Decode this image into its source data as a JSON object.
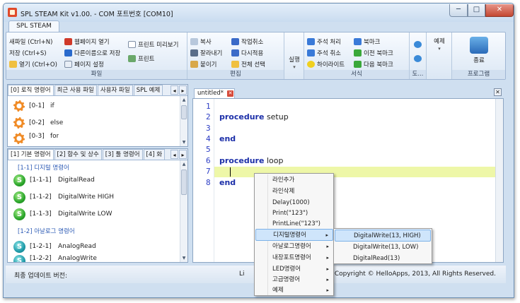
{
  "window": {
    "title": "SPL STEAM Kit v1.00.  - COM 포트번호 [COM10]",
    "min": "─",
    "max": "□",
    "close": "✕"
  },
  "ribbon": {
    "tab": "SPL STEAM",
    "file": {
      "label": "파일",
      "new": "새파일 (Ctrl+N)",
      "save": "저장 (Ctrl+S)",
      "open": "열기 (Ctrl+O)",
      "open_webpage": "웹페이지 열기",
      "save_as": "다른이름으로 저장",
      "page_setup": "페이지 설정",
      "print_preview": "프린트 미리보기",
      "print": "프린트"
    },
    "edit": {
      "label": "편집",
      "copy": "복사",
      "cut": "잘라내기",
      "paste": "붙이기",
      "undo": "작업취소",
      "redo": "다시적용",
      "select_all": "전체 선택"
    },
    "run": {
      "label": "실행",
      "arrow": "▾"
    },
    "format": {
      "label": "서식",
      "comment": "주석 처리",
      "uncomment": "주석 취소",
      "highlight": "하이라이트",
      "bookmark": "북마크",
      "prev_bookmark": "이전 북마크",
      "next_bookmark": "다음 북마크"
    },
    "misc": {
      "label": "도..."
    },
    "example": {
      "label": "예제",
      "arrow": "▾"
    },
    "program": {
      "label": "프로그램",
      "exit": "종료"
    }
  },
  "left_top": {
    "tabs": [
      "[0] 로직 명령어",
      "최근 사용 파일",
      "사용자 파일",
      "SPL 예제"
    ],
    "nav_prev": "◂",
    "nav_next": "▸",
    "items": [
      {
        "code": "[0-1]",
        "name": "if"
      },
      {
        "code": "[0-2]",
        "name": "else"
      },
      {
        "code": "[0-3]",
        "name": "for"
      }
    ]
  },
  "left_bottom": {
    "tabs": [
      "[1] 기본 명령어",
      "[2] 함수 및 상수",
      "[3] 툴 명령어",
      "[4] 화"
    ],
    "nav_prev": "◂",
    "nav_next": "▸",
    "section1": "[1-1]  디지털 명령어",
    "section2": "[1-2]  아날로그 명령어",
    "badge": "S",
    "items": [
      {
        "code": "[1-1-1]",
        "name": "DigitalRead"
      },
      {
        "code": "[1-1-2]",
        "name": "DigitalWrite HIGH"
      },
      {
        "code": "[1-1-3]",
        "name": "DigitalWrite LOW"
      },
      {
        "code": "[1-2-1]",
        "name": "AnalogRead"
      },
      {
        "code": "[1-2-2]",
        "name": "AnalogWrite"
      }
    ]
  },
  "editor": {
    "tab": "untitled*",
    "tab_close": "✕",
    "panel_close": "✕",
    "lines": [
      "1",
      "2",
      "3",
      "4",
      "5",
      "6",
      "7",
      "8"
    ],
    "kw_procedure": "procedure",
    "setup": "setup",
    "end": "end",
    "loop": "loop"
  },
  "context_menu": {
    "items": [
      "라인추가",
      "라인삭제",
      "Delay(1000)",
      "Print(\"123\")",
      "PrintLine(\"123\")",
      "디지털명령어",
      "아날로그명령어",
      "내장포트명령어",
      "LED명령어",
      "고급명령어",
      "예제"
    ],
    "arrow": "▸"
  },
  "submenu": {
    "items": [
      "DigitalWrite(13, HIGH)",
      "DigitalWrite(13, LOW)",
      "DigitalRead(13)"
    ]
  },
  "status": {
    "left": "최종 업데이트 버전:",
    "mid": "Li",
    "right": "Copyright © HelloApps, 2013, All Rights Reserved."
  },
  "colors": {
    "window_bg": "#cfdff0",
    "keyword": "#1b2ea8",
    "line_number": "#2b3cc4",
    "current_line": "#eef7a8",
    "menu_highlight": "#cfe5fb"
  }
}
